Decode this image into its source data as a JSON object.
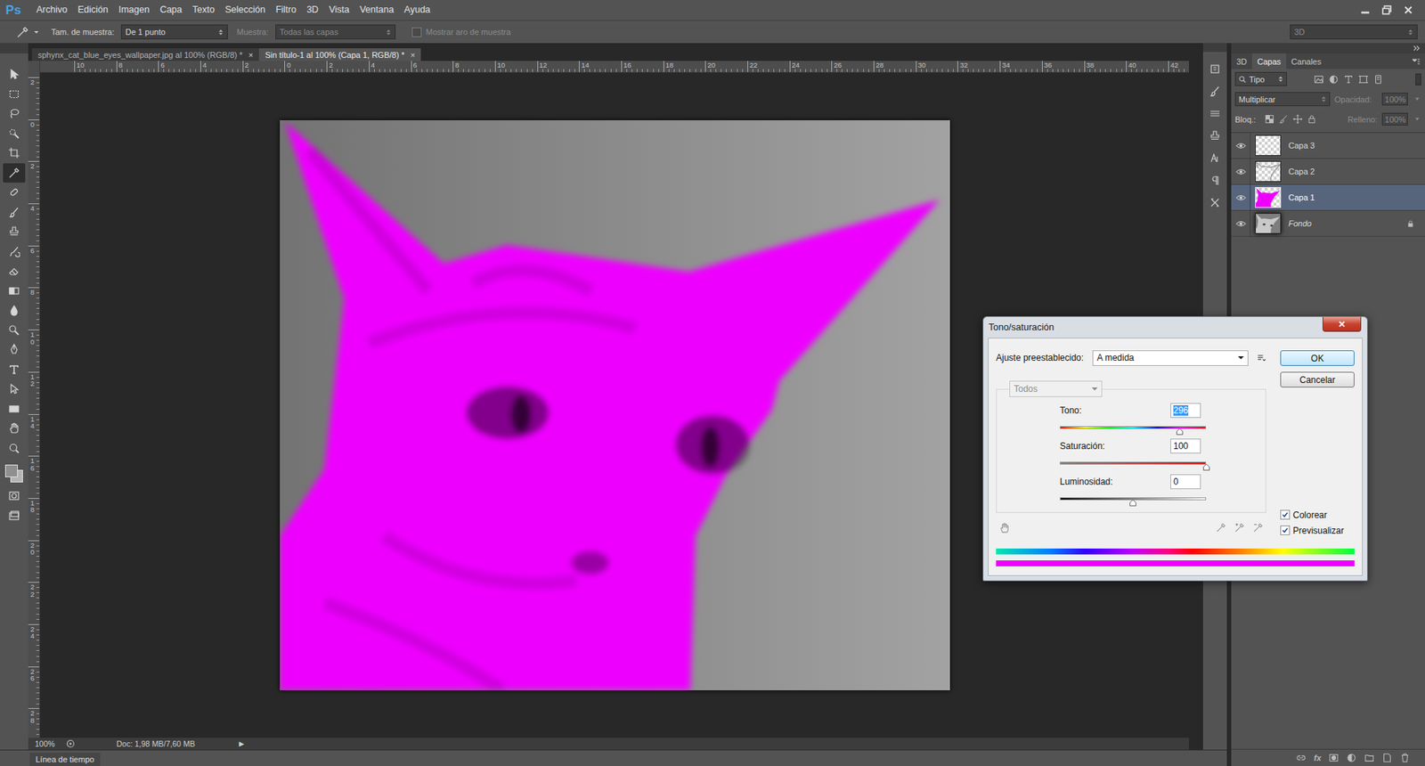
{
  "app": {
    "logo": "Ps"
  },
  "menu": [
    "Archivo",
    "Edición",
    "Imagen",
    "Capa",
    "Texto",
    "Selección",
    "Filtro",
    "3D",
    "Vista",
    "Ventana",
    "Ayuda"
  ],
  "options_bar": {
    "sample_size_label": "Tam. de muestra:",
    "sample_size": "De 1 punto",
    "sample_label": "Muestra:",
    "sample": "Todas las capas",
    "sample_disabled": true,
    "ring_label": "Mostrar aro de muestra",
    "ring_checked": false,
    "ring_disabled": true,
    "workspace": "3D"
  },
  "tools": [
    {
      "selected": false
    },
    {
      "selected": false
    },
    {
      "selected": false
    },
    {
      "selected": false
    },
    {
      "selected": false
    },
    {
      "selected": true
    },
    {
      "selected": false
    },
    {
      "selected": false
    },
    {
      "selected": false
    },
    {
      "selected": false
    },
    {
      "selected": false
    },
    {
      "selected": false
    },
    {
      "selected": false
    },
    {
      "selected": false
    },
    {
      "selected": false
    },
    {
      "selected": false
    },
    {
      "selected": false
    },
    {
      "selected": false
    },
    {
      "selected": false
    },
    {
      "selected": false
    }
  ],
  "document_tabs": [
    {
      "label": "sphynx_cat_blue_eyes_wallpaper.jpg al 100% (RGB/8) *",
      "close": "×",
      "selected": false
    },
    {
      "label": "Sin título-1 al 100% (Capa 1, RGB/8) *",
      "close": "×",
      "selected": true
    }
  ],
  "rulers": {
    "horizontal": [
      "10",
      "8",
      "6",
      "4",
      "2",
      "0",
      "2",
      "4",
      "6",
      "8",
      "10",
      "12",
      "14",
      "16",
      "18",
      "20",
      "22",
      "24",
      "26",
      "28",
      "30",
      "32",
      "34",
      "36",
      "38",
      "40",
      "42"
    ],
    "vertical": [
      "2",
      "0",
      "2",
      "4",
      "6",
      "8",
      "10",
      "12",
      "14",
      "16",
      "18",
      "20",
      "22",
      "24",
      "26",
      "28"
    ]
  },
  "status_bar": {
    "zoom": "100%",
    "doc": "Doc: 1,98 MB/7,60 MB",
    "arrow": "▶"
  },
  "timeline": {
    "label": "Línea de tiempo"
  },
  "layers_panel": {
    "tabs": [
      {
        "label": "3D",
        "selected": false
      },
      {
        "label": "Capas",
        "selected": true
      },
      {
        "label": "Canales",
        "selected": false
      }
    ],
    "filter": "Tipo",
    "blend_mode": "Multiplicar",
    "opacity_label": "Opacidad:",
    "opacity": "100%",
    "lock_label": "Bloq.:",
    "fill_label": "Relleno:",
    "fill": "100%",
    "controls_disabled": true,
    "footer_fx": "fx",
    "layers": [
      {
        "name": "Capa 3",
        "visible": true,
        "selected": false,
        "locked": false,
        "background": false,
        "kind": "empty"
      },
      {
        "name": "Capa 2",
        "visible": true,
        "selected": false,
        "locked": false,
        "background": false,
        "kind": "sketch"
      },
      {
        "name": "Capa 1",
        "visible": true,
        "selected": true,
        "locked": false,
        "background": false,
        "kind": "fill"
      },
      {
        "name": "Fondo",
        "visible": true,
        "selected": false,
        "locked": true,
        "background": true,
        "kind": "photo"
      }
    ]
  },
  "dialog": {
    "title": "Tono/saturación",
    "close": "✕",
    "preset_label": "Ajuste preestablecido:",
    "preset": "A medida",
    "buttons": [
      {
        "label": "OK",
        "default": true
      },
      {
        "label": "Cancelar",
        "default": false
      }
    ],
    "channel": "Todos",
    "channel_disabled": true,
    "sliders": [
      {
        "label": "Tono:",
        "value": "296",
        "level": 0.822,
        "value_selected": true,
        "kind": "hue"
      },
      {
        "label": "Saturación:",
        "value": "100",
        "level": 1,
        "value_selected": false,
        "kind": "saturation"
      },
      {
        "label": "Luminosidad:",
        "value": "0",
        "level": 0.5,
        "value_selected": false,
        "kind": "lightness"
      }
    ],
    "checkboxes": [
      {
        "label": "Colorear",
        "checked": true
      },
      {
        "label": "Previsualizar",
        "checked": true
      }
    ]
  }
}
